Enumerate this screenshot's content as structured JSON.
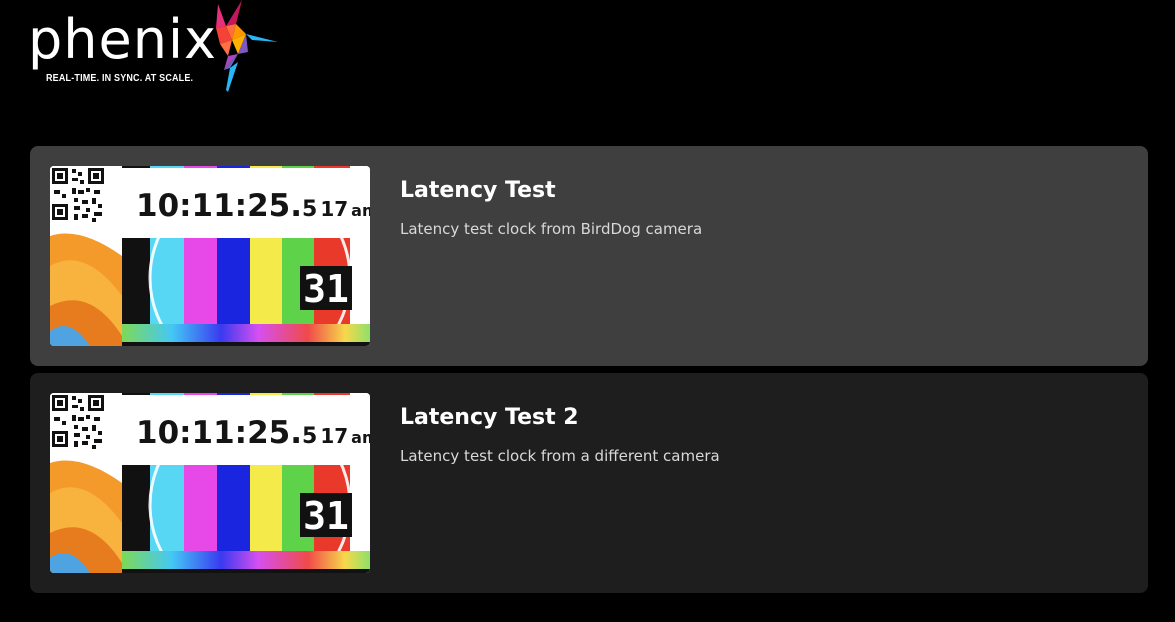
{
  "header": {
    "logo_word": "phenix",
    "logo_tagline": "REAL-TIME. IN SYNC. AT SCALE."
  },
  "streams": [
    {
      "title": "Latency Test",
      "description": "Latency test clock from BirdDog camera",
      "thumbnail": {
        "clock_main": "10:11:25.",
        "clock_ms": "5",
        "clock_frac": "17",
        "clock_ampm": "am",
        "counter": "31"
      }
    },
    {
      "title": "Latency Test 2",
      "description": "Latency test clock from a different camera",
      "thumbnail": {
        "clock_main": "10:11:25.",
        "clock_ms": "5",
        "clock_frac": "17",
        "clock_ampm": "am",
        "counter": "31"
      }
    }
  ],
  "colors": {
    "background": "#000000",
    "card_selected": "#3f3f3f",
    "card_default": "#1e1e1e",
    "title_text": "#ffffff",
    "desc_text": "#d8d8d8"
  }
}
